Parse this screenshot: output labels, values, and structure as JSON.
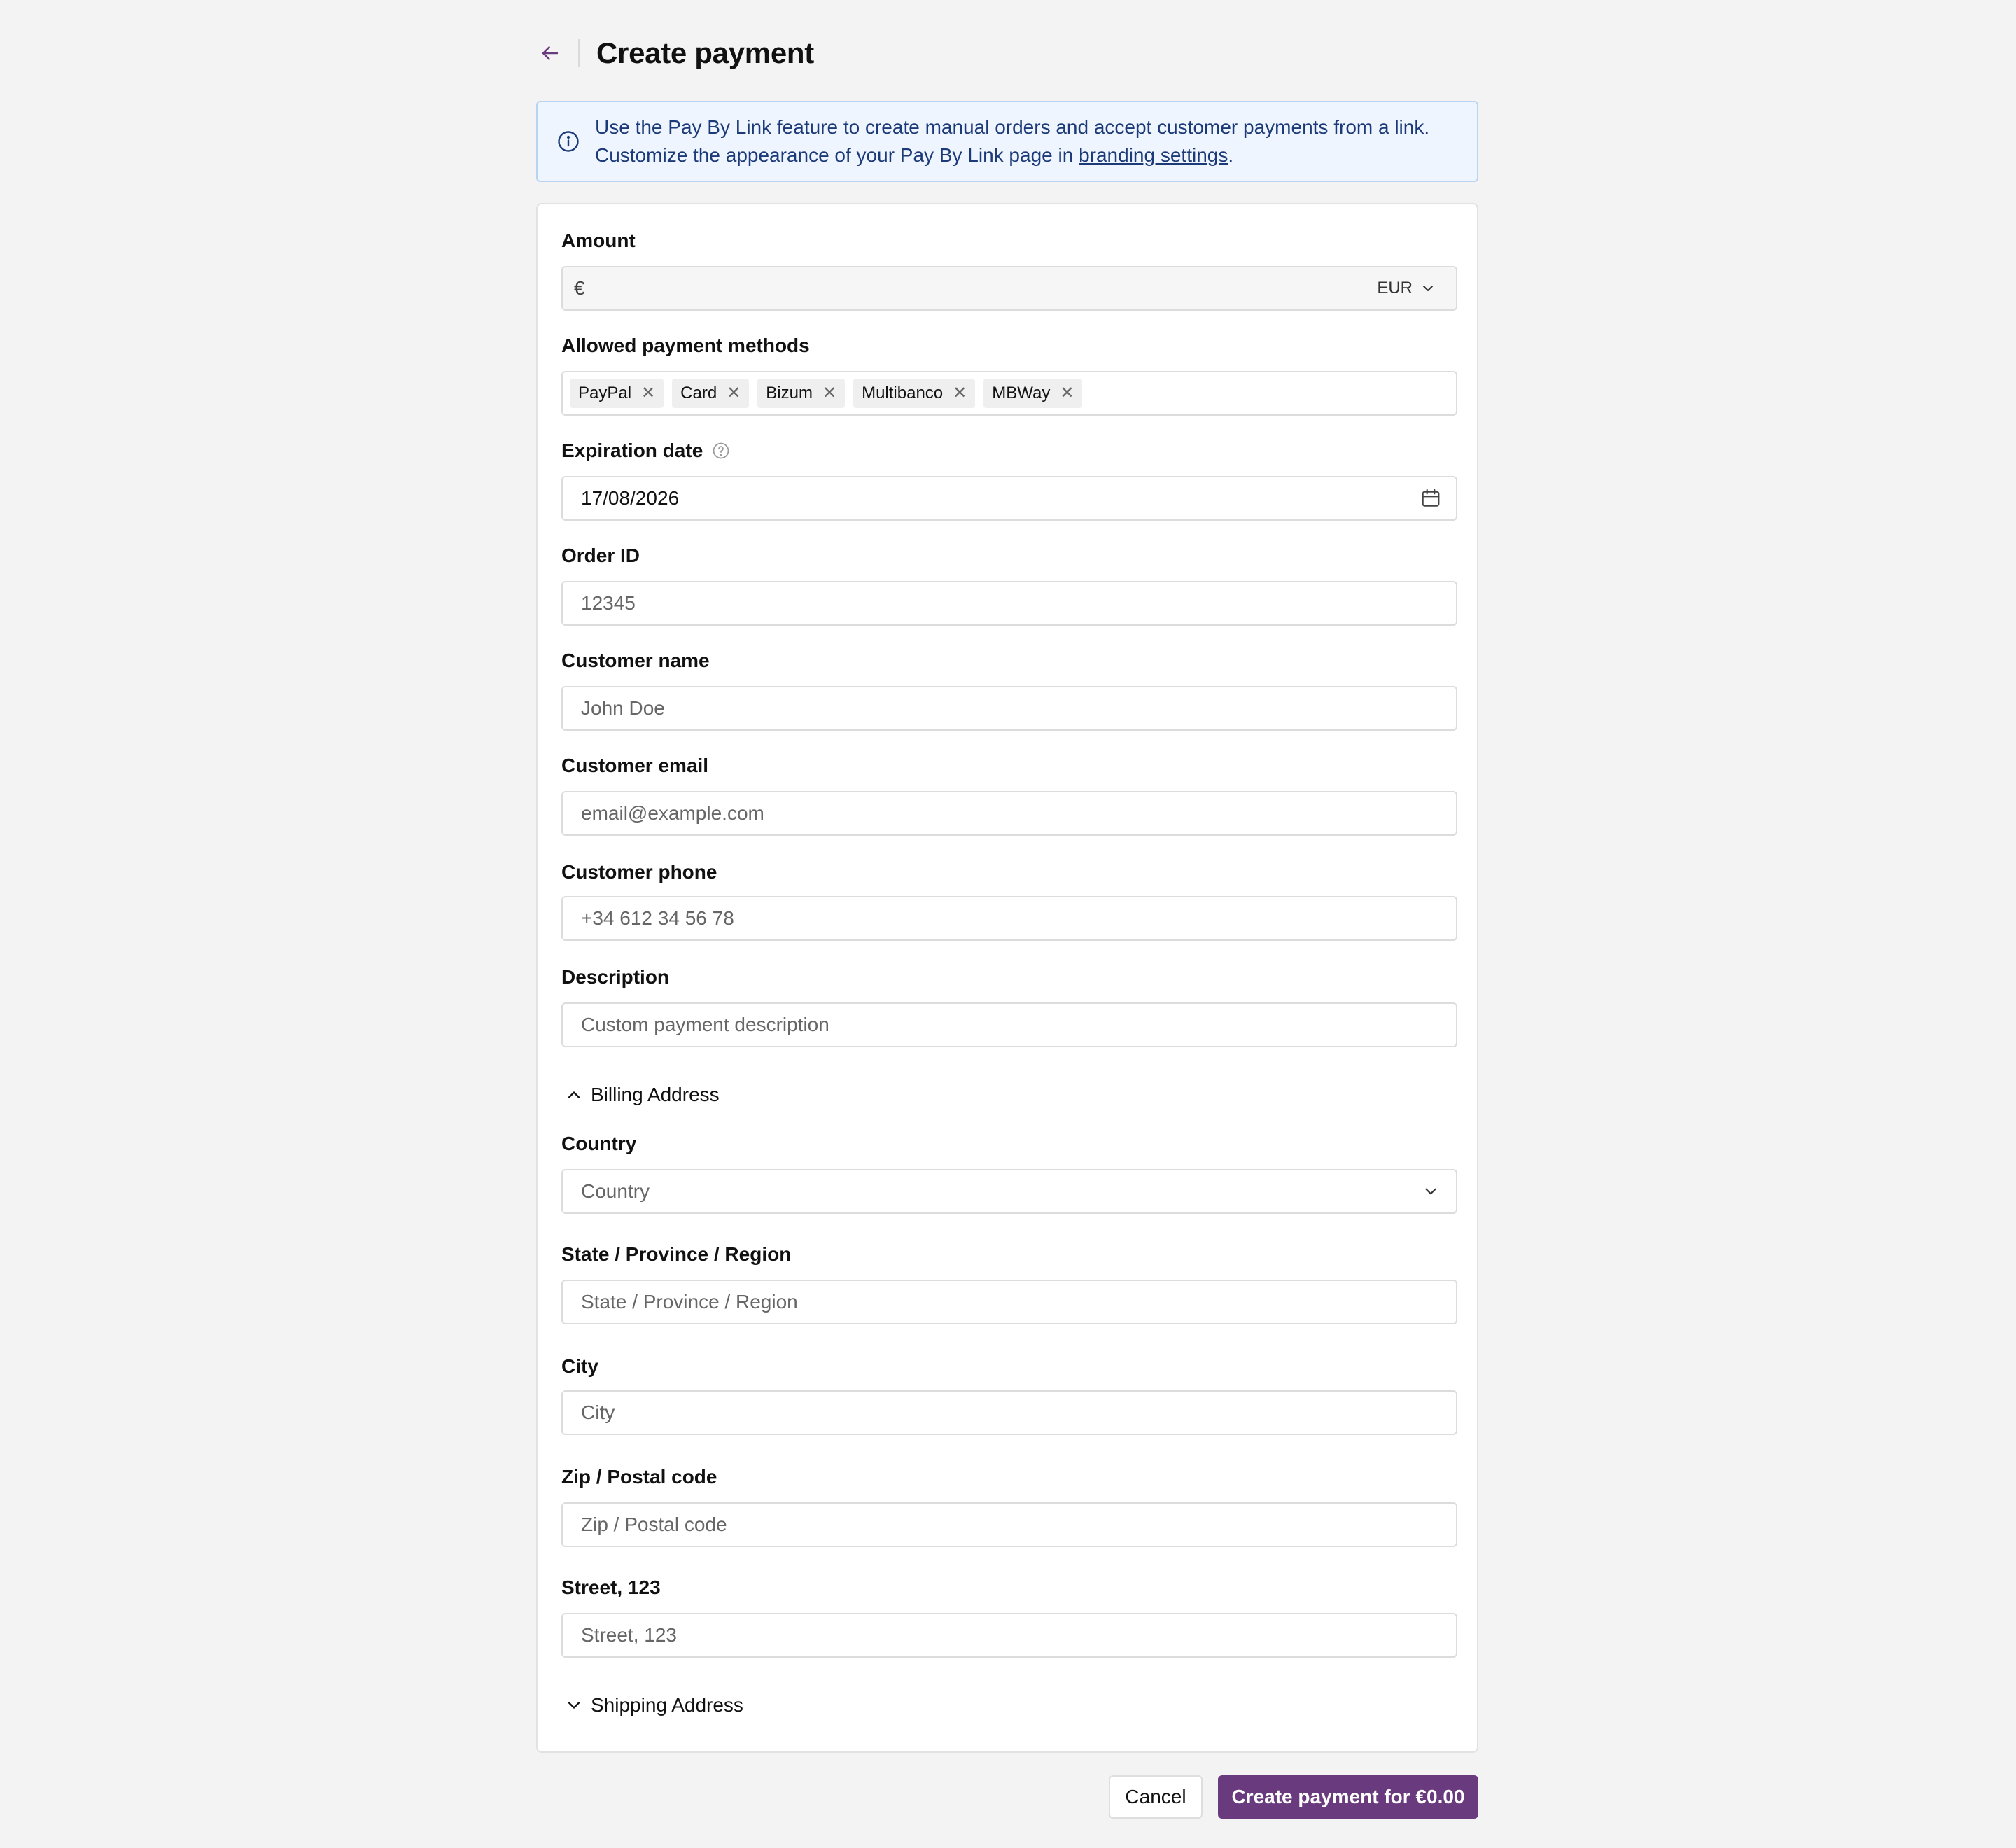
{
  "header": {
    "title": "Create payment"
  },
  "info_banner": {
    "line1": "Use the Pay By Link feature to create manual orders and accept customer payments from a link.",
    "line2_prefix": "Customize the appearance of your Pay By Link page in ",
    "link_text": "branding settings",
    "line2_suffix": "."
  },
  "form": {
    "amount": {
      "label": "Amount",
      "currency_symbol": "€",
      "currency": "EUR",
      "value": ""
    },
    "payment_methods": {
      "label": "Allowed payment methods",
      "chips": [
        "PayPal",
        "Card",
        "Bizum",
        "Multibanco",
        "MBWay"
      ]
    },
    "expiration": {
      "label": "Expiration date",
      "value": "17/08/2026"
    },
    "order_id": {
      "label": "Order ID",
      "placeholder": "12345"
    },
    "customer_name": {
      "label": "Customer name",
      "placeholder": "John Doe"
    },
    "customer_email": {
      "label": "Customer email",
      "placeholder": "email@example.com"
    },
    "customer_phone": {
      "label": "Customer phone",
      "placeholder": "+34 612 34 56 78"
    },
    "description": {
      "label": "Description",
      "placeholder": "Custom payment description"
    },
    "billing": {
      "toggle_label": "Billing Address",
      "country": {
        "label": "Country",
        "placeholder": "Country"
      },
      "state": {
        "label": "State / Province / Region",
        "placeholder": "State / Province / Region"
      },
      "city": {
        "label": "City",
        "placeholder": "City"
      },
      "zip": {
        "label": "Zip / Postal code",
        "placeholder": "Zip / Postal code"
      },
      "street": {
        "label": "Street, 123",
        "placeholder": "Street, 123"
      }
    },
    "shipping": {
      "toggle_label": "Shipping Address"
    }
  },
  "footer": {
    "cancel_label": "Cancel",
    "create_label": "Create payment for €0.00"
  },
  "colors": {
    "primary": "#6a3a7e",
    "info_bg": "#eef5ff",
    "info_text": "#1c3a78"
  }
}
